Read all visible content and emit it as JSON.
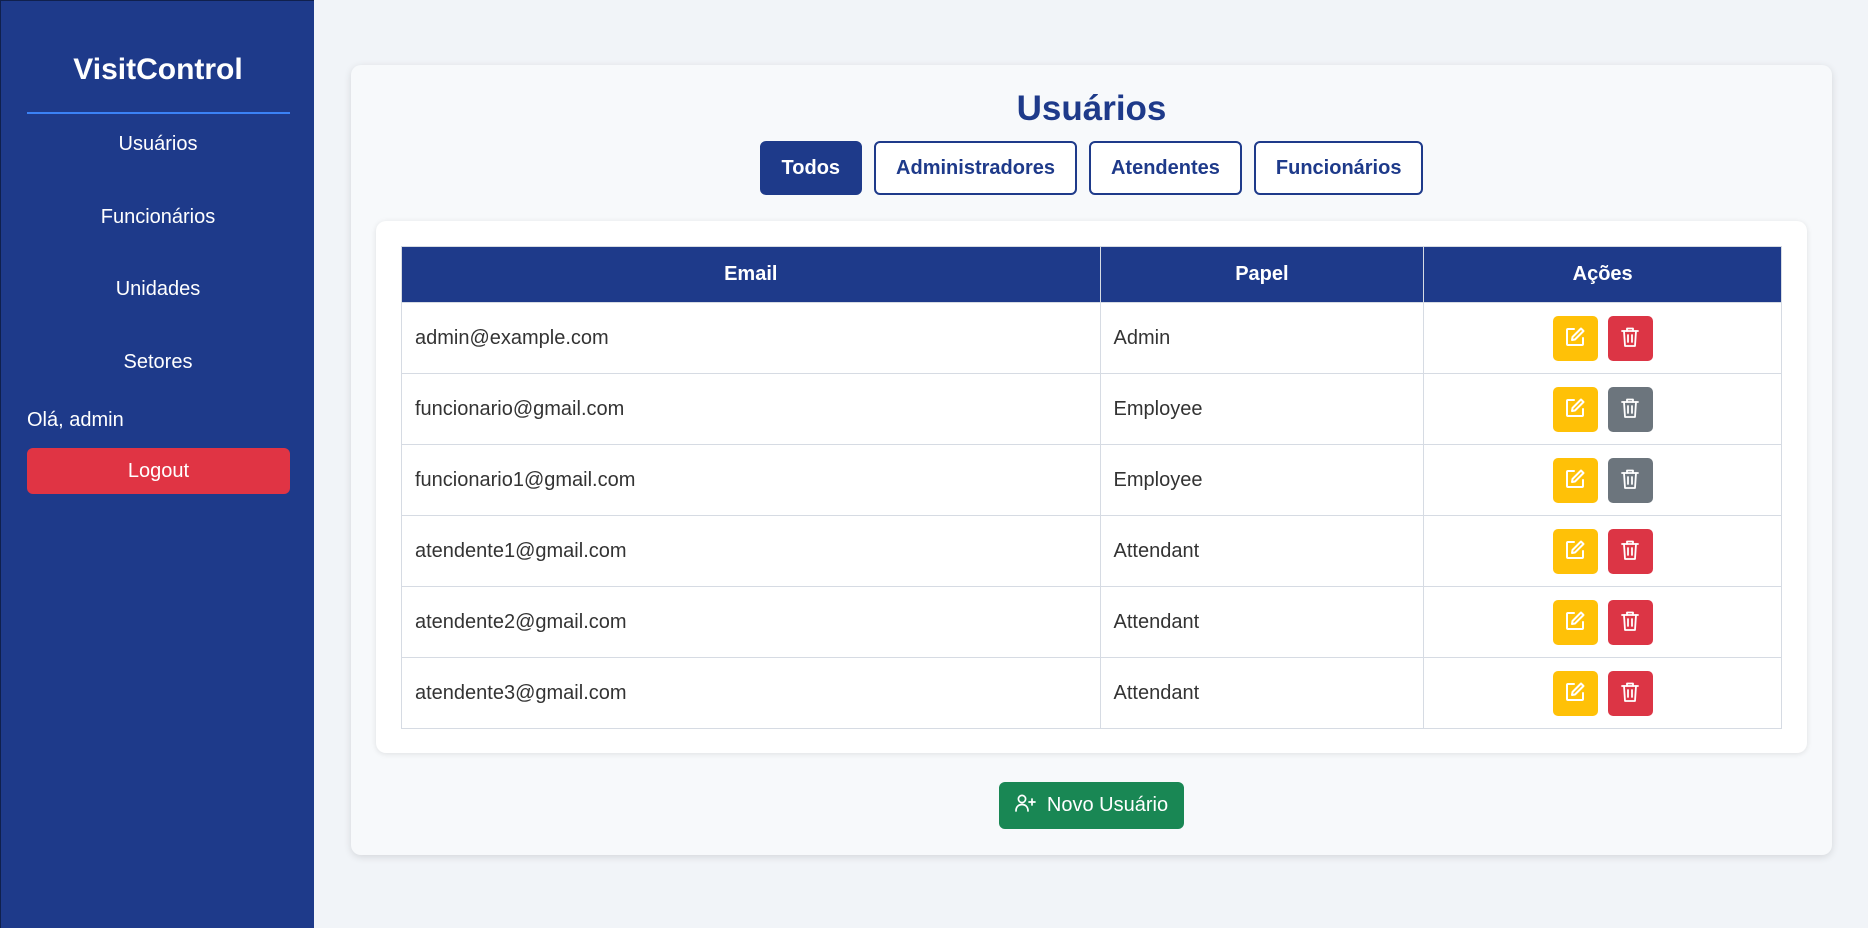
{
  "sidebar": {
    "brand": "VisitControl",
    "nav": [
      "Usuários",
      "Funcionários",
      "Unidades",
      "Setores"
    ],
    "greeting": "Olá, admin",
    "logout_label": "Logout",
    "colors": {
      "background": "#1e3a8a",
      "divider": "#3b82f6",
      "logout": "#e03444"
    }
  },
  "main": {
    "title": "Usuários",
    "tabs": [
      {
        "label": "Todos",
        "active": true
      },
      {
        "label": "Administradores",
        "active": false
      },
      {
        "label": "Atendentes",
        "active": false
      },
      {
        "label": "Funcionários",
        "active": false
      }
    ],
    "table": {
      "headers": [
        "Email",
        "Papel",
        "Ações"
      ],
      "rows": [
        {
          "email": "admin@example.com",
          "role": "Admin",
          "delete_enabled": true
        },
        {
          "email": "funcionario@gmail.com",
          "role": "Employee",
          "delete_enabled": false
        },
        {
          "email": "funcionario1@gmail.com",
          "role": "Employee",
          "delete_enabled": false
        },
        {
          "email": "atendente1@gmail.com",
          "role": "Attendant",
          "delete_enabled": true
        },
        {
          "email": "atendente2@gmail.com",
          "role": "Attendant",
          "delete_enabled": true
        },
        {
          "email": "atendente3@gmail.com",
          "role": "Attendant",
          "delete_enabled": true
        }
      ],
      "icons": {
        "edit": "edit-icon",
        "delete": "trash-icon"
      }
    },
    "new_user_label": "Novo Usuário",
    "new_user_icon": "user-plus-icon",
    "colors": {
      "accent": "#1e3a8a",
      "edit": "#ffc107",
      "delete": "#dc3545",
      "delete_disabled": "#6c757d",
      "new_user": "#198754"
    }
  }
}
